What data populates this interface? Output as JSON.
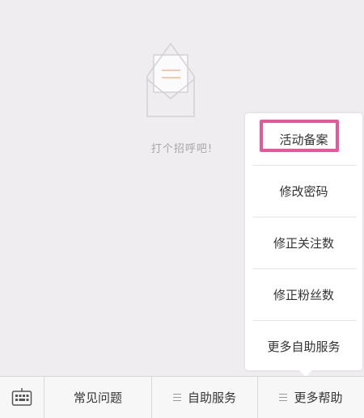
{
  "empty_state": {
    "icon": "open-envelope-icon",
    "message": "打个招呼吧!"
  },
  "popup_menu": {
    "items": [
      {
        "label": "活动备案",
        "highlighted": true
      },
      {
        "label": "修改密码"
      },
      {
        "label": "修正关注数"
      },
      {
        "label": "修正粉丝数"
      },
      {
        "label": "更多自助服务"
      }
    ],
    "highlight_color": "#e8579a"
  },
  "bottom_nav": {
    "keyboard_icon": "keyboard-icon",
    "tabs": [
      {
        "label": "常见问题"
      },
      {
        "label": "自助服务",
        "icon": "menu-lines-icon"
      },
      {
        "label": "更多帮助",
        "icon": "menu-lines-icon"
      }
    ]
  }
}
